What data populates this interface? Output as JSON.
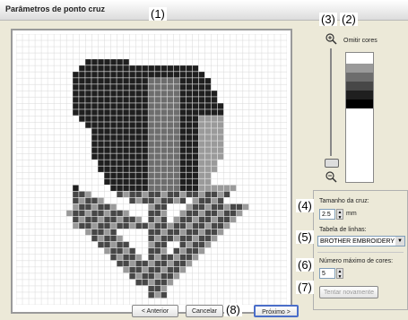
{
  "window": {
    "title": "Parâmetros de ponto cruz"
  },
  "callouts": {
    "c1": "(1)",
    "c2": "(2)",
    "c3": "(3)",
    "c4": "(4)",
    "c5": "(5)",
    "c6": "(6)",
    "c7": "(7)",
    "c8": "(8)"
  },
  "colors": {
    "omit_label": "Omitir cores",
    "swatches": [
      "#9a9a9a",
      "#6d6d6d",
      "#474747",
      "#1f1f1f",
      "#000000"
    ]
  },
  "settings": {
    "cross_size_label": "Tamanho da cruz:",
    "cross_size_value": "2.5",
    "cross_size_unit": "mm",
    "thread_table_label": "Tabela de linhas:",
    "thread_table_value": "BROTHER EMBROIDERY",
    "max_colors_label": "Número máximo de cores:",
    "max_colors_value": "5",
    "retry_button": "Tentar novamente"
  },
  "footer": {
    "back": "< Anterior",
    "cancel": "Cancelar",
    "next": "Próximo >"
  }
}
